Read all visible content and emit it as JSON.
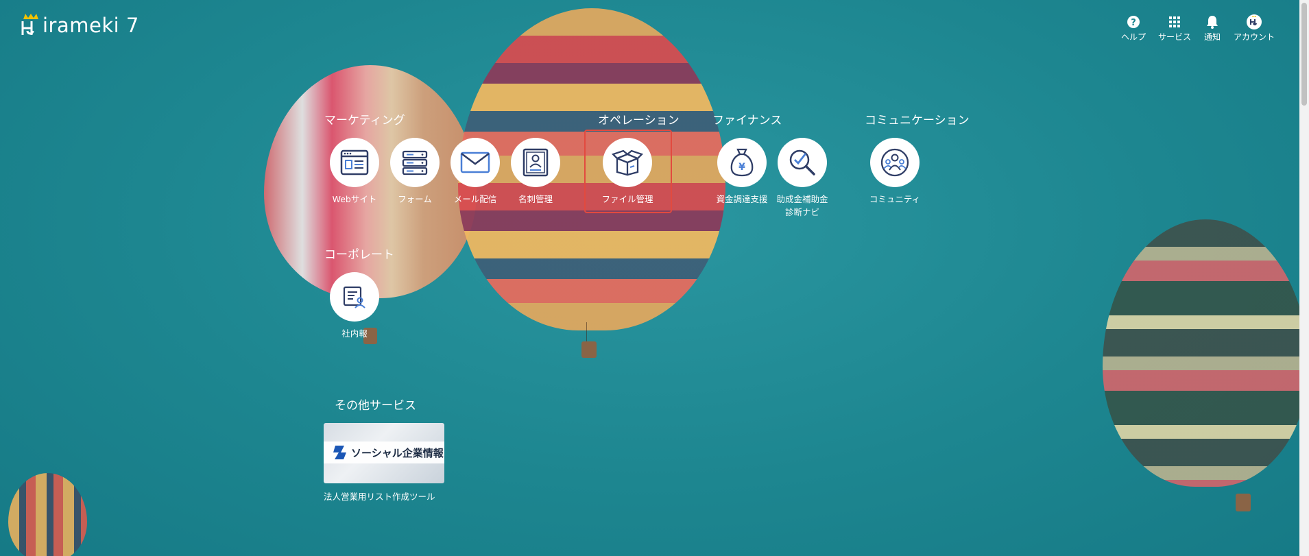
{
  "brand": {
    "logo_text": "Hirameki 7",
    "logo_text_tail": "irameki 7"
  },
  "top_nav": {
    "help": {
      "label": "ヘルプ",
      "icon": "question-circle-icon"
    },
    "services": {
      "label": "サービス",
      "icon": "grid-icon"
    },
    "notifications": {
      "label": "通知",
      "icon": "bell-icon"
    },
    "account": {
      "label": "アカウント",
      "icon": "user-icon"
    }
  },
  "categories": {
    "marketing": "マーケティング",
    "operation": "オペレーション",
    "finance": "ファイナンス",
    "communication": "コミュニケーション",
    "corporate": "コーポレート",
    "other": "その他サービス"
  },
  "apps": {
    "website": "Webサイト",
    "form": "フォーム",
    "mail": "メール配信",
    "business_card": "名刺管理",
    "file_management": "ファイル管理",
    "funding": "資金調達支援",
    "subsidy": "助成金補助金\n診断ナビ",
    "community": "コミュニティ",
    "internal_news": "社内報"
  },
  "other_service": {
    "banner_text": "ソーシャル企業情報",
    "caption": "法人営業用リスト作成ツール"
  },
  "colors": {
    "accent_icon": "#2f3d66",
    "icon_blue": "#4a7fd6",
    "selection": "#e24a3f"
  }
}
